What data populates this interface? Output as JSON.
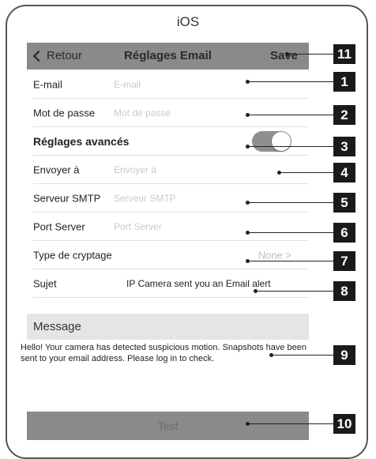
{
  "os_label": "iOS",
  "navbar": {
    "back_label": "Retour",
    "title": "Réglages Email",
    "save_label": "Save"
  },
  "fields": [
    {
      "label": "E-mail",
      "placeholder": "E-mail"
    },
    {
      "label": "Mot de passe",
      "placeholder": "Mot de passe"
    },
    {
      "label": "Réglages avancés",
      "toggle_on": true
    },
    {
      "label": "Envoyer à",
      "placeholder": "Envoyer à"
    },
    {
      "label": "Serveur SMTP",
      "placeholder": "Serveur SMTP"
    },
    {
      "label": "Port Server",
      "placeholder": "Port Server"
    },
    {
      "label": "Type de cryptage",
      "value": "None",
      "chevron": ">"
    },
    {
      "label": "Sujet",
      "value": "IP Camera sent you an Email alert"
    }
  ],
  "message": {
    "header": "Message",
    "text": "Hello! Your camera has detected suspicious motion. Snapshots have been sent to your email address. Please log in to check."
  },
  "test_button_label": "Test",
  "callouts": [
    "11",
    "1",
    "2",
    "3",
    "4",
    "5",
    "6",
    "7",
    "8",
    "9",
    "10"
  ],
  "colors": {
    "navbar": "#8a8a8a",
    "toggle": "#8f8f8f",
    "section_header": "#e5e5e5",
    "badge": "#1a1a1a"
  }
}
